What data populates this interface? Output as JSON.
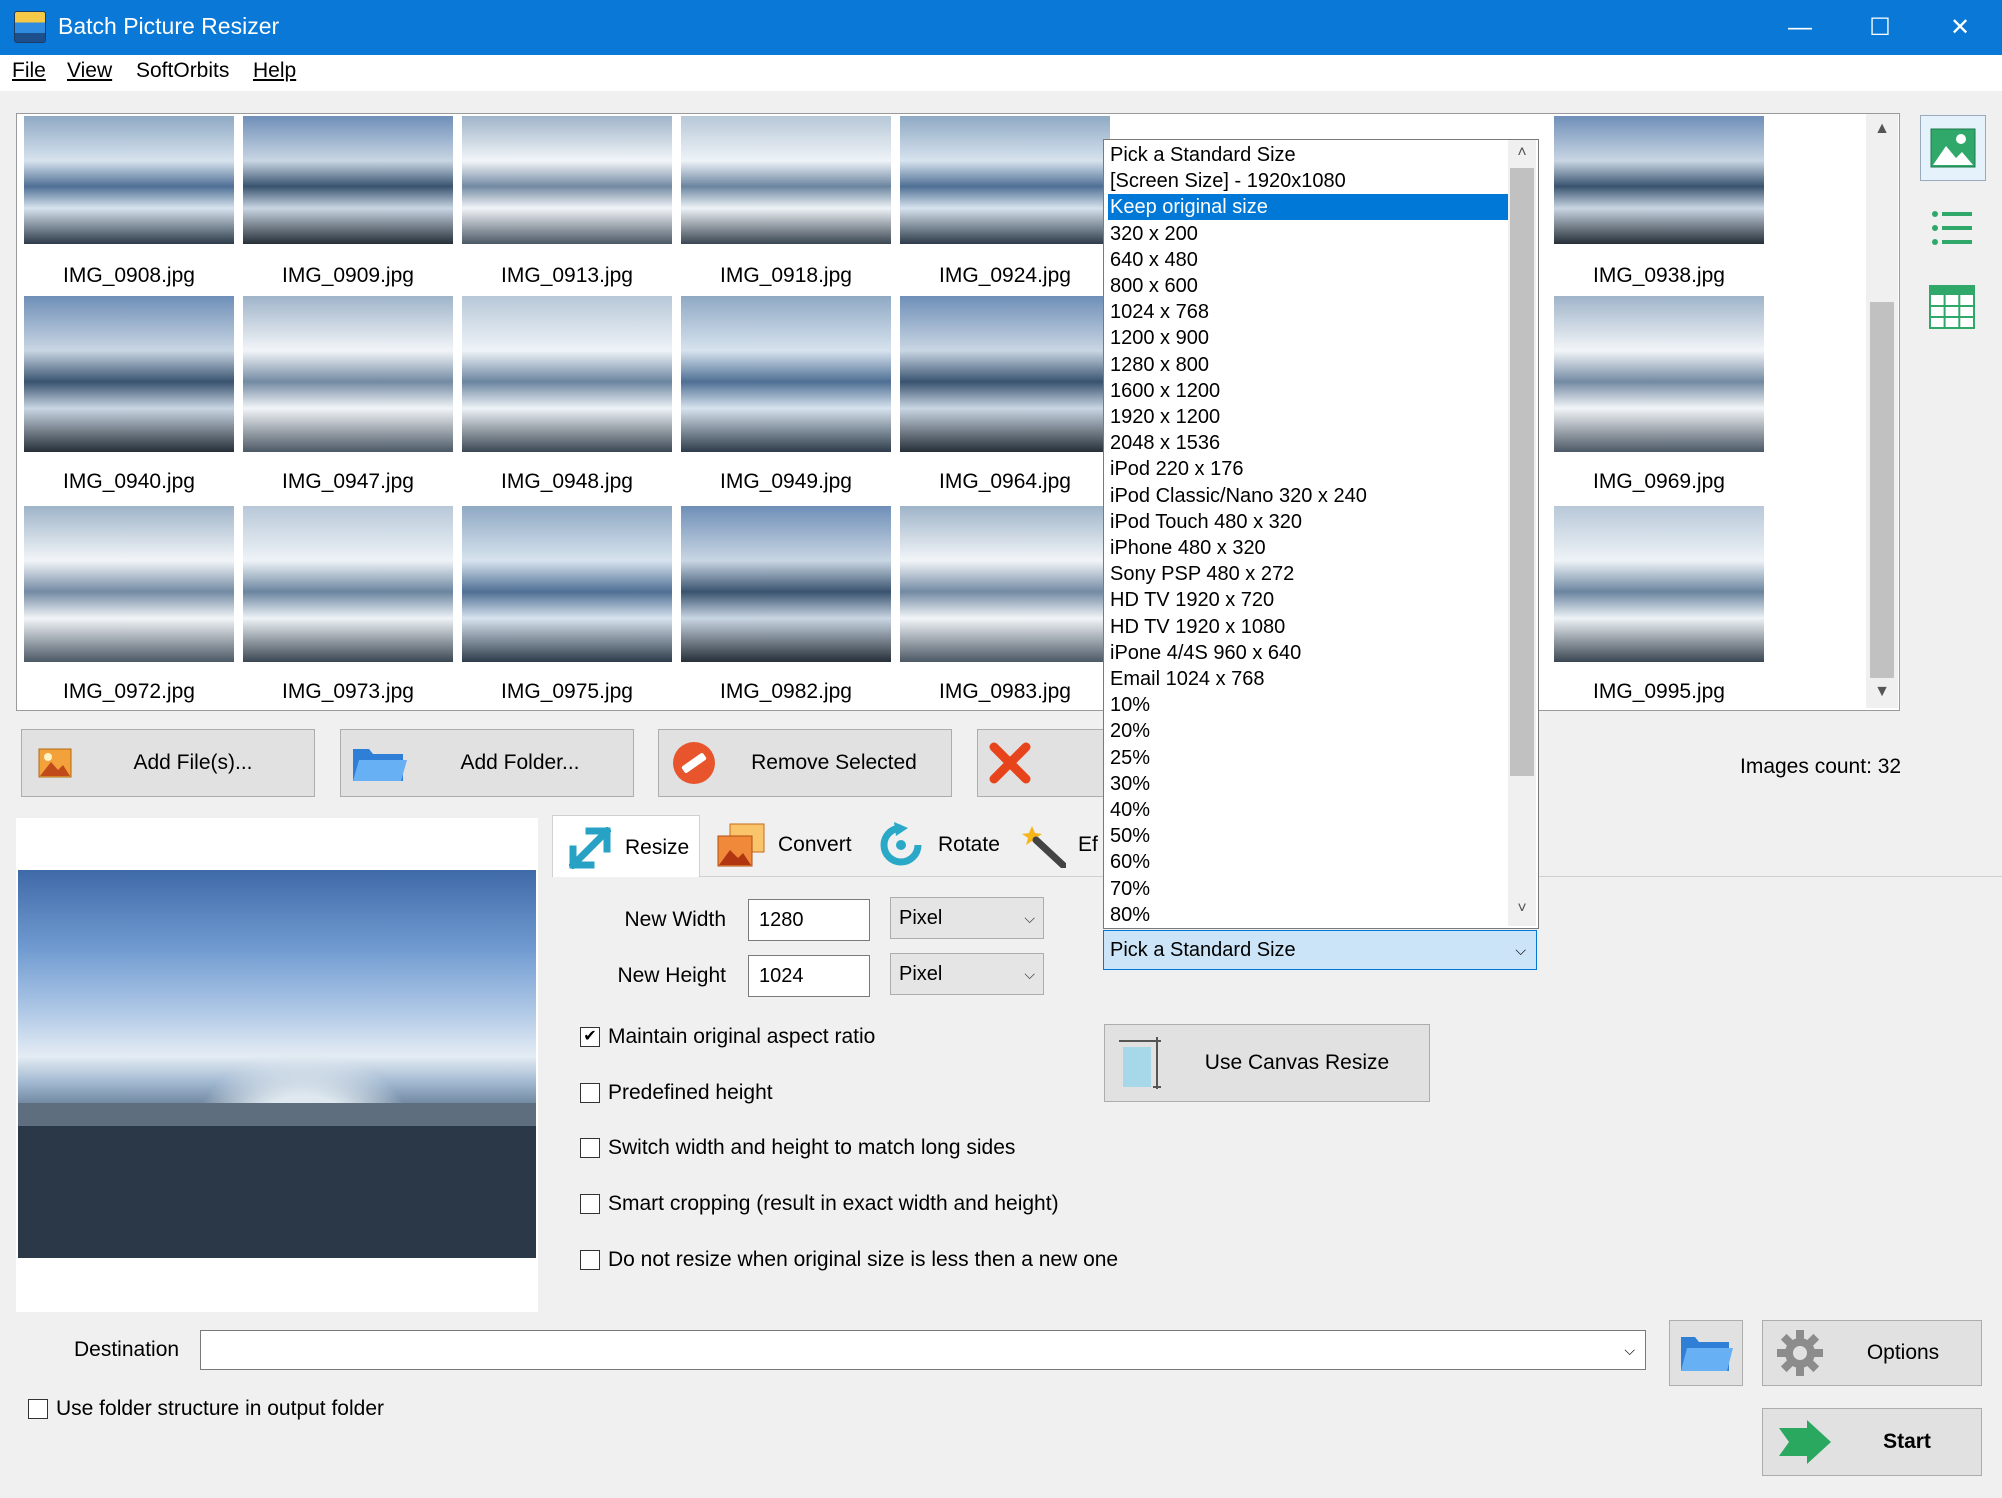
{
  "window": {
    "title": "Batch Picture Resizer",
    "minimize": "—",
    "maximize": "☐",
    "close": "✕"
  },
  "menu": [
    "File",
    "View",
    "SoftOrbits",
    "Help"
  ],
  "thumbnails": [
    "IMG_0908.jpg",
    "IMG_0909.jpg",
    "IMG_0913.jpg",
    "IMG_0918.jpg",
    "IMG_0924.jpg",
    "IMG_0938.jpg",
    "IMG_0940.jpg",
    "IMG_0947.jpg",
    "IMG_0948.jpg",
    "IMG_0949.jpg",
    "IMG_0964.jpg",
    "IMG_0969.jpg",
    "IMG_0972.jpg",
    "IMG_0973.jpg",
    "IMG_0975.jpg",
    "IMG_0982.jpg",
    "IMG_0983.jpg",
    "IMG_0995.jpg"
  ],
  "actions": {
    "add_files": "Add File(s)...",
    "add_folder": "Add Folder...",
    "remove_selected": "Remove Selected"
  },
  "images_count": "Images count: 32",
  "tabs": [
    "Resize",
    "Convert",
    "Rotate",
    "Ef"
  ],
  "resize": {
    "new_width_label": "New Width",
    "new_width_value": "1280",
    "new_height_label": "New Height",
    "new_height_value": "1024",
    "width_unit": "Pixel",
    "height_unit": "Pixel",
    "options": [
      {
        "label": "Maintain original aspect ratio",
        "checked": true
      },
      {
        "label": "Predefined height",
        "checked": false
      },
      {
        "label": "Switch width and height to match long sides",
        "checked": false
      },
      {
        "label": "Smart cropping (result in exact width and height)",
        "checked": false
      },
      {
        "label": "Do not resize when original size is less then a new one",
        "checked": false
      }
    ],
    "canvas_resize": "Use Canvas Resize",
    "standard_size_value": "Pick a Standard Size"
  },
  "standard_sizes": [
    "Pick a Standard Size",
    "[Screen Size] - 1920x1080",
    "Keep original size",
    "320 x 200",
    "640 x 480",
    "800 x 600",
    "1024 x 768",
    "1200 x 900",
    "1280 x 800",
    "1600 x 1200",
    "1920 x 1200",
    "2048 x 1536",
    "iPod 220 x 176",
    "iPod Classic/Nano 320 x 240",
    "iPod Touch 480 x 320",
    "iPhone 480 x 320",
    "Sony PSP 480 x 272",
    "HD TV 1920 x 720",
    "HD TV 1920 x 1080",
    "iPone 4/4S 960 x 640",
    "Email 1024 x 768",
    "10%",
    "20%",
    "25%",
    "30%",
    "40%",
    "50%",
    "60%",
    "70%",
    "80%"
  ],
  "standard_sizes_selected": "Keep original size",
  "destination": {
    "label": "Destination",
    "value": "",
    "use_folder_structure": "Use folder structure in output folder"
  },
  "buttons": {
    "options": "Options",
    "start": "Start"
  },
  "colors": {
    "titlebar": "#0a78d7",
    "selection": "#0078d7"
  }
}
